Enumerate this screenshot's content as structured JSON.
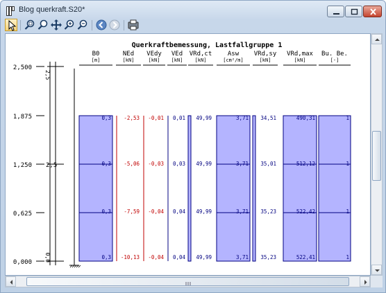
{
  "window": {
    "title": "Blog querkraft.S20*"
  },
  "toolbar": {
    "buttons": [
      {
        "name": "select-pointer-icon"
      },
      {
        "name": "zoom-window-icon"
      },
      {
        "name": "zoom-icon"
      },
      {
        "name": "pan-icon"
      },
      {
        "name": "zoom-in-icon"
      },
      {
        "name": "zoom-out-icon"
      },
      {
        "name": "back-icon"
      },
      {
        "name": "forward-icon"
      },
      {
        "name": "print-preview-icon"
      }
    ]
  },
  "diagram": {
    "title": "Querkraftbemessung, Lastfallgruppe 1",
    "axis_labels": [
      "2,500",
      "1,875",
      "1,250",
      "0,625",
      "0,000"
    ],
    "inner_axis_labels": [
      "2,5",
      "2,5",
      "0,0"
    ],
    "columns": [
      {
        "name": "B0",
        "unit": "[m]",
        "values": [
          "0,3",
          "0,3",
          "0,3",
          "0,3"
        ],
        "style": "filled",
        "color": "#000080"
      },
      {
        "name": "NEd",
        "unit": "[kN]",
        "values": [
          "-2,53",
          "-5,06",
          "-7,59",
          "-10,13"
        ],
        "style": "line",
        "color": "#c00000"
      },
      {
        "name": "VEdy",
        "unit": "[kN]",
        "values": [
          "-0,01",
          "-0,03",
          "-0,04",
          "-0,04"
        ],
        "style": "line",
        "color": "#c00000"
      },
      {
        "name": "VEd",
        "unit": "[kN]",
        "values": [
          "0,01",
          "0,03",
          "0,04",
          "0,04"
        ],
        "style": "line",
        "color": "#000080"
      },
      {
        "name": "VRd,ct",
        "unit": "[kN]",
        "values": [
          "49,99",
          "49,99",
          "49,99",
          "49,99"
        ],
        "style": "thin",
        "color": "#000080"
      },
      {
        "name": "Asw",
        "unit": "[cm²/m]",
        "values": [
          "3,71",
          "3,71",
          "3,71",
          "3,71"
        ],
        "style": "filled",
        "color": "#000080"
      },
      {
        "name": "VRd,sy",
        "unit": "[kN]",
        "values": [
          "34,51",
          "35,01",
          "35,23",
          "35,23"
        ],
        "style": "thin",
        "color": "#000080"
      },
      {
        "name": "VRd,max",
        "unit": "[kN]",
        "values": [
          "490,31",
          "512,12",
          "522,42",
          "522,41"
        ],
        "style": "filled",
        "color": "#000080"
      },
      {
        "name": "Bu. Be.",
        "unit": "[-]",
        "values": [
          "1",
          "1",
          "1",
          "1"
        ],
        "style": "filled",
        "color": "#000080"
      }
    ]
  },
  "colors": {
    "fill": "#b4b4ff",
    "outline": "#000080",
    "negative": "#c00000"
  }
}
